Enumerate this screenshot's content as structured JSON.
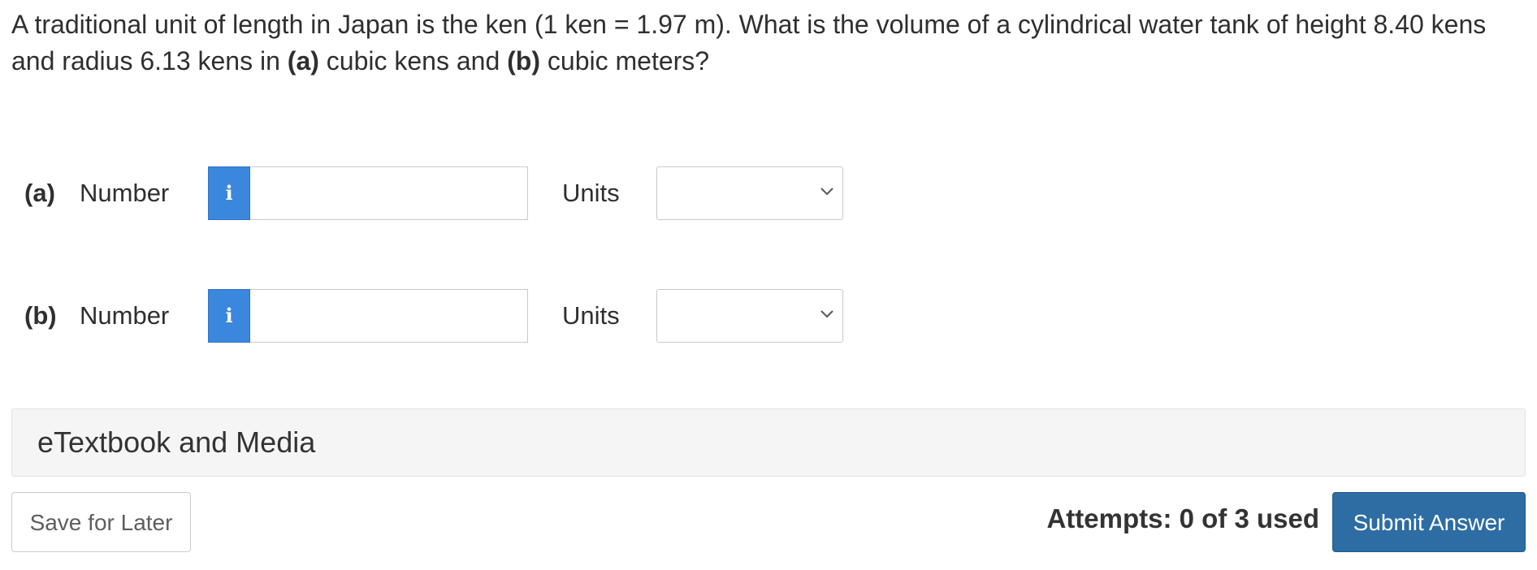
{
  "question": {
    "text_before_a": "A traditional unit of length in Japan is the ken (1 ken = 1.97 m). What is the volume of a cylindrical water tank of height 8.40 kens and radius 6.13 kens in ",
    "part_a_marker": "(a)",
    "text_between": " cubic kens and ",
    "part_b_marker": "(b)",
    "text_after_b": " cubic meters?"
  },
  "answers": [
    {
      "part_label": "(a)",
      "number_label": "Number",
      "info_icon": "i",
      "number_value": "",
      "units_label": "Units",
      "units_selected": ""
    },
    {
      "part_label": "(b)",
      "number_label": "Number",
      "info_icon": "i",
      "number_value": "",
      "units_label": "Units",
      "units_selected": ""
    }
  ],
  "etextbook": {
    "label": "eTextbook and Media"
  },
  "footer": {
    "save_label": "Save for Later",
    "attempts_text": "Attempts: 0 of 3 used",
    "submit_label": "Submit Answer"
  },
  "colors": {
    "info_button": "#3b87dd",
    "submit_button": "#2d6da3",
    "panel_background": "#f5f5f5"
  },
  "icons": {
    "info": "info-icon",
    "dropdown": "chevron-down-icon"
  }
}
